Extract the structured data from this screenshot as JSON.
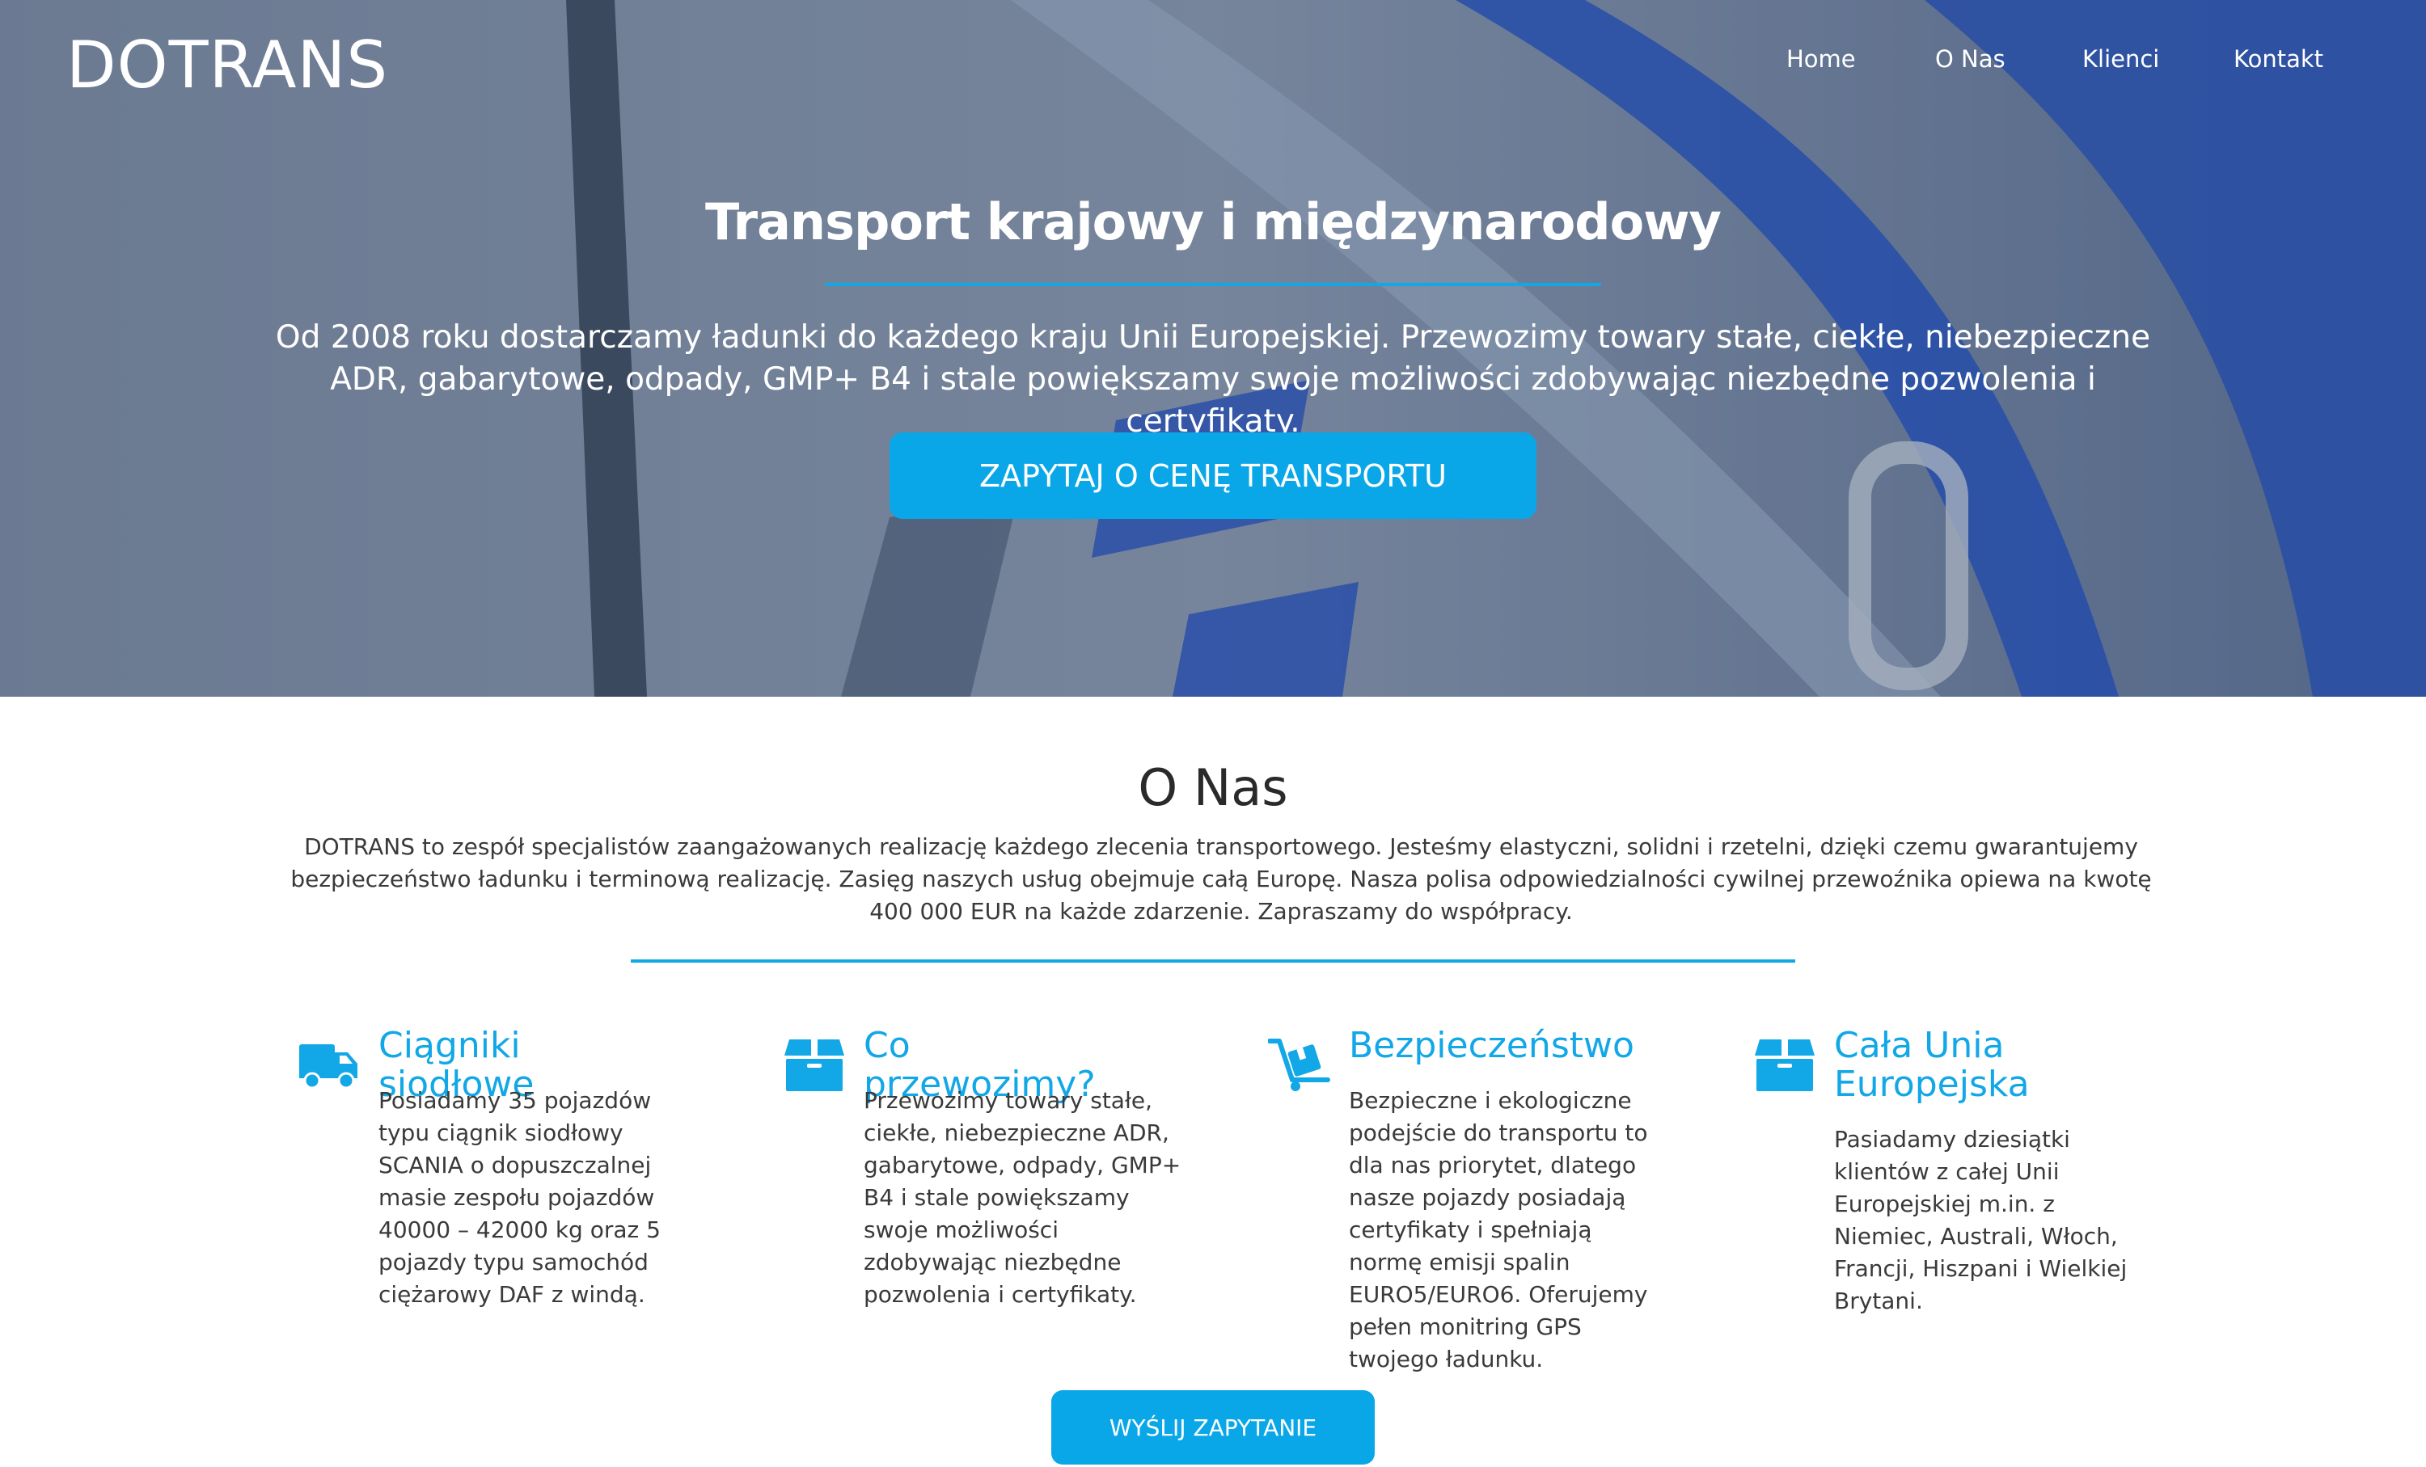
{
  "brand": {
    "logo_text": "DOTRANS"
  },
  "nav": {
    "items": [
      "Home",
      "O Nas",
      "Klienci",
      "Kontakt"
    ]
  },
  "hero": {
    "title": "Transport krajowy i międzynarodowy",
    "description": "Od 2008 roku dostarczamy ładunki do każdego kraju Unii Europejskiej. Przewozimy towary stałe, ciekłe, niebezpieczne ADR, gabarytowe, odpady, GMP+ B4 i stale powiększamy swoje możliwości zdobywając niezbędne pozwolenia i certyfikaty.",
    "cta_label": "ZAPYTAJ O CENĘ TRANSPORTU"
  },
  "about": {
    "title": "O Nas",
    "text": "DOTRANS to zespół specjalistów zaangażowanych realizację każdego zlecenia transportowego. Jesteśmy elastyczni, solidni i rzetelni, dzięki czemu gwarantujemy bezpieczeństwo ładunku i terminową realizację. Zasięg naszych usług obejmuje całą Europę. Nasza polisa odpowiedzialności cywilnej przewoźnika opiewa na kwotę 400 000 EUR na każde zdarzenie. Zapraszamy do współpracy.",
    "features": [
      {
        "icon": "truck-icon",
        "title": "Ciągniki siodłowe",
        "text": "Posiadamy 35 pojazdów typu ciągnik siodłowy SCANIA o dopuszczalnej masie zespołu pojazdów 40000 – 42000 kg oraz 5 pojazdy typu samochód ciężarowy DAF z windą."
      },
      {
        "icon": "box-icon",
        "title": "Co przewozimy?",
        "text": "Przewozimy towary stałe, ciekłe, niebezpieczne ADR, gabarytowe, odpady, GMP+ B4 i stale powiększamy swoje możliwości zdobywając niezbędne pozwolenia i certyfikaty."
      },
      {
        "icon": "dolly-icon",
        "title": "Bezpieczeństwo",
        "text": "Bezpieczne i ekologiczne podejście do transportu to dla nas priorytet, dlatego nasze pojazdy posiadają certyfikaty i spełniają normę emisji spalin EURO5/EURO6. Oferujemy pełen monitring GPS twojego ładunku."
      },
      {
        "icon": "box-icon",
        "title": "Cała Unia Europejska",
        "text": "Pasiadamy dziesiątki klientów z całej Unii Europejskiej m.in. z Niemiec, Australi, Włoch, Francji, Hiszpani i Wielkiej Brytani."
      }
    ],
    "send_label": "WYŚLIJ ZAPYTANIE"
  },
  "colors": {
    "accent": "#0aa7e8",
    "hero_overlay": "#6f7f97",
    "truck_blue": "#1f4fc0"
  }
}
